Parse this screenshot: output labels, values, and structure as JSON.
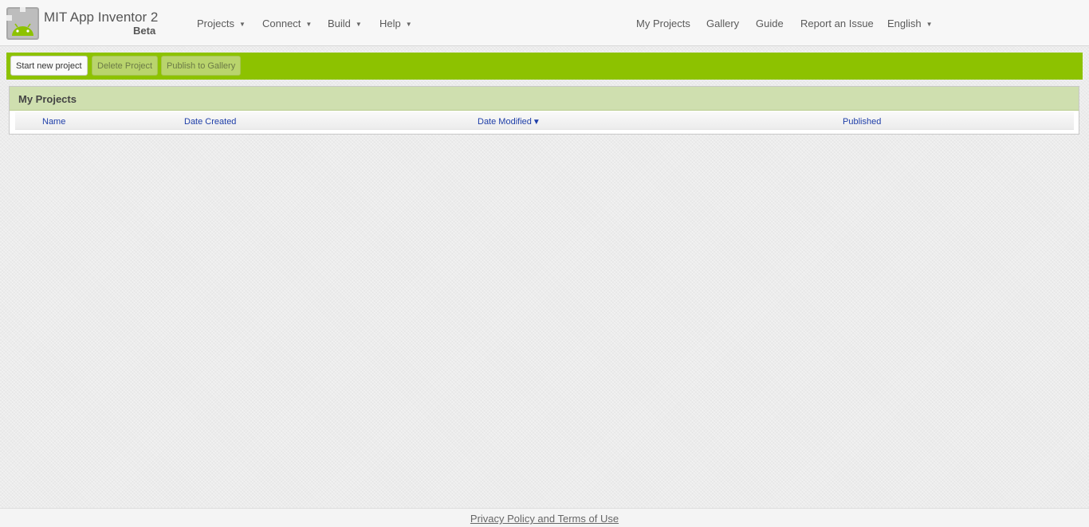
{
  "header": {
    "app_title": "MIT App Inventor 2",
    "app_subtitle": "Beta",
    "menus": [
      {
        "label": "Projects"
      },
      {
        "label": "Connect"
      },
      {
        "label": "Build"
      },
      {
        "label": "Help"
      }
    ],
    "links": [
      {
        "label": "My Projects"
      },
      {
        "label": "Gallery"
      },
      {
        "label": "Guide"
      },
      {
        "label": "Report an Issue"
      }
    ],
    "language": "English"
  },
  "toolbar": {
    "start_new_label": "Start new project",
    "delete_label": "Delete Project",
    "publish_label": "Publish to Gallery"
  },
  "projects_panel": {
    "title": "My Projects",
    "columns": [
      "Name",
      "Date Created",
      "Date Modified",
      "Published"
    ],
    "sort_indicator": "▼"
  },
  "footer": {
    "link_text": "Privacy Policy and Terms of Use"
  },
  "colors": {
    "toolbar_green": "#8dc200",
    "panel_header": "#cfdfaf",
    "link_blue": "#1e3ea8"
  },
  "icons": {
    "logo": "android-logo-icon",
    "dropdown": "caret-down-icon",
    "sort": "sort-desc-icon"
  }
}
